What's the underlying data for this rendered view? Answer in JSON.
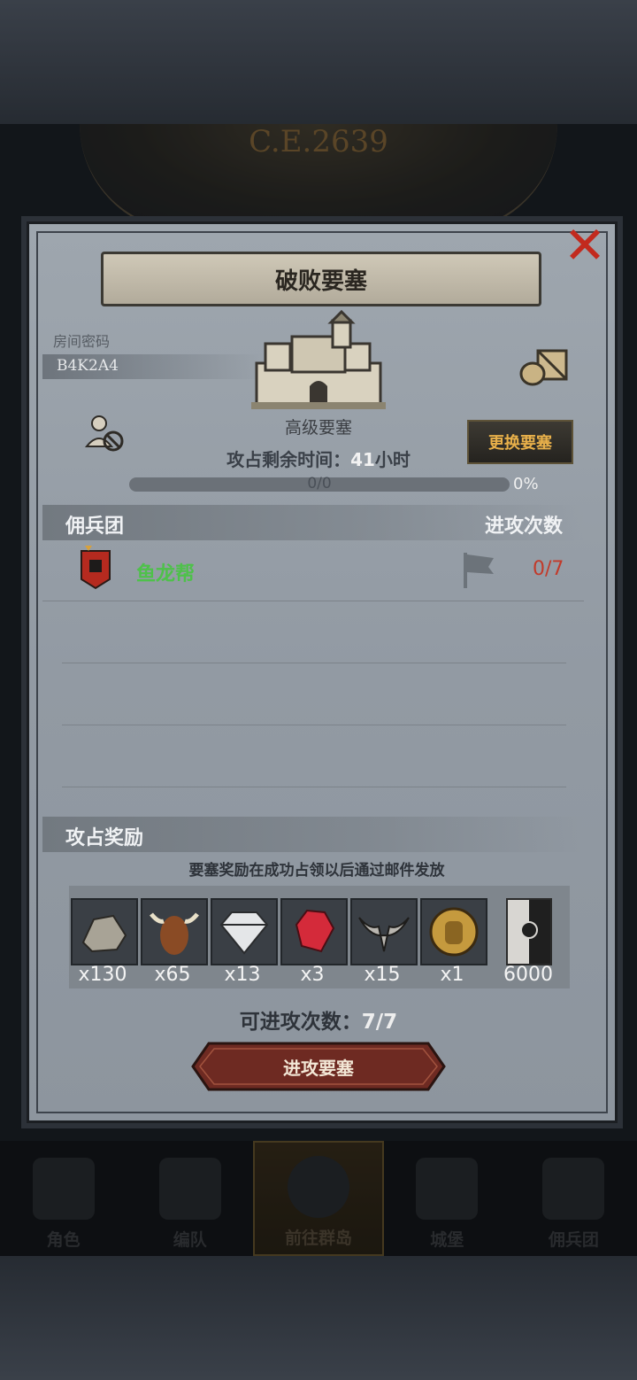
{
  "header": {
    "era": "C.E.2639"
  },
  "dialog": {
    "title": "破败要塞",
    "room_code_label": "房间密码",
    "room_code": "B4K2A4",
    "fortress_grade": "高级要塞",
    "time_label": "攻占剩余时间：",
    "time_value": "41",
    "time_unit": "小时",
    "change_button": "更换要塞",
    "progress_text": "0/0",
    "progress_percent": "0%",
    "progress_fraction": 0
  },
  "mercenary": {
    "header_left": "佣兵团",
    "header_right": "进攻次数",
    "rows": [
      {
        "name": "鱼龙帮",
        "attacks": "0/7"
      }
    ]
  },
  "rewards": {
    "title": "攻占奖励",
    "note": "要塞奖励在成功占领以后通过邮件发放",
    "items": [
      {
        "icon": "stone-icon",
        "qty": "x130"
      },
      {
        "icon": "bull-icon",
        "qty": "x65"
      },
      {
        "icon": "diamond-icon",
        "qty": "x13"
      },
      {
        "icon": "ruby-icon",
        "qty": "x3"
      },
      {
        "icon": "horn-mask-icon",
        "qty": "x15"
      },
      {
        "icon": "knight-coin-icon",
        "qty": "x1"
      },
      {
        "icon": "guild-banner-icon",
        "qty": "6000"
      }
    ]
  },
  "footer": {
    "remaining_label": "可进攻次数：",
    "remaining_value": "7/7",
    "attack_button": "进攻要塞"
  },
  "nav": {
    "items": [
      {
        "label": "角色"
      },
      {
        "label": "编队"
      },
      {
        "label": "前往群岛"
      },
      {
        "label": "城堡"
      },
      {
        "label": "佣兵团"
      }
    ]
  },
  "colors": {
    "accent": "#e8b04a",
    "guild": "#4ec14a",
    "danger": "#c23a2a"
  }
}
